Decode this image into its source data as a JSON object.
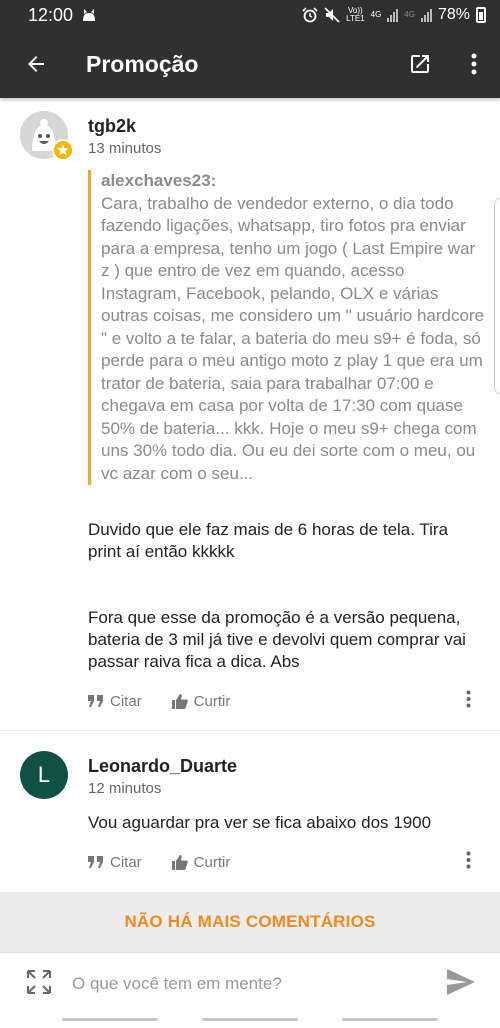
{
  "status_bar": {
    "time": "12:00",
    "volte_top": "Vo))",
    "volte_bottom": "LTE1",
    "net1": "4G",
    "net2": "4G",
    "battery": "78%",
    "icons": [
      "cat-notification-icon",
      "alarm-icon",
      "mute-icon",
      "volte-icon",
      "signal-icon",
      "battery-icon"
    ]
  },
  "app_bar": {
    "title": "Promoção",
    "icons": [
      "back-arrow-icon",
      "external-link-icon",
      "more-vert-icon"
    ]
  },
  "comments": [
    {
      "username": "tgb2k",
      "time": "13 minutos",
      "quote": {
        "author": "alexchaves23:",
        "text": "Cara, trabalho de vendedor externo, o dia todo fazendo ligações, whatsapp, tiro fotos pra enviar para a empresa, tenho um jogo ( Last Empire war z ) que entro de vez em quando, acesso Instagram, Facebook, pelando, OLX e várias outras coisas, me considero um \" usuário hardcore \" e volto a te falar, a bateria do meu s9+ é foda, só perde para o meu antigo moto z play 1 que era um trator de bateria, saia para trabalhar 07:00 e chegava em casa por volta de 17:30 com quase 50% de bateria... kkk. Hoje o meu s9+ chega com uns 30% todo dia. Ou eu dei sorte com o meu, ou vc azar com o seu..."
      },
      "paragraph1": "Duvido que ele faz mais de 6 horas de tela. Tira print aí então kkkkk",
      "paragraph2": "Fora que esse da promoção é a versão pequena, bateria de 3 mil já tive e devolvi quem comprar vai passar raiva fica a dica. Abs",
      "quote_label": "Citar",
      "like_label": "Curtir"
    },
    {
      "username": "Leonardo_Duarte",
      "avatar_letter": "L",
      "avatar_color": "#0f5143",
      "time": "12 minutos",
      "text": "Vou aguardar pra ver se fica abaixo dos 1900",
      "quote_label": "Citar",
      "like_label": "Curtir"
    }
  ],
  "no_more_comments": "NÃO HÁ MAIS COMENTÁRIOS",
  "comment_input": {
    "placeholder": "O que você tem em mente?",
    "value": ""
  },
  "colors": {
    "app_bar": "#303030",
    "accent_orange": "#f08a1c",
    "quote_bar": "#f5a623",
    "badge_yellow": "#f5b700"
  }
}
